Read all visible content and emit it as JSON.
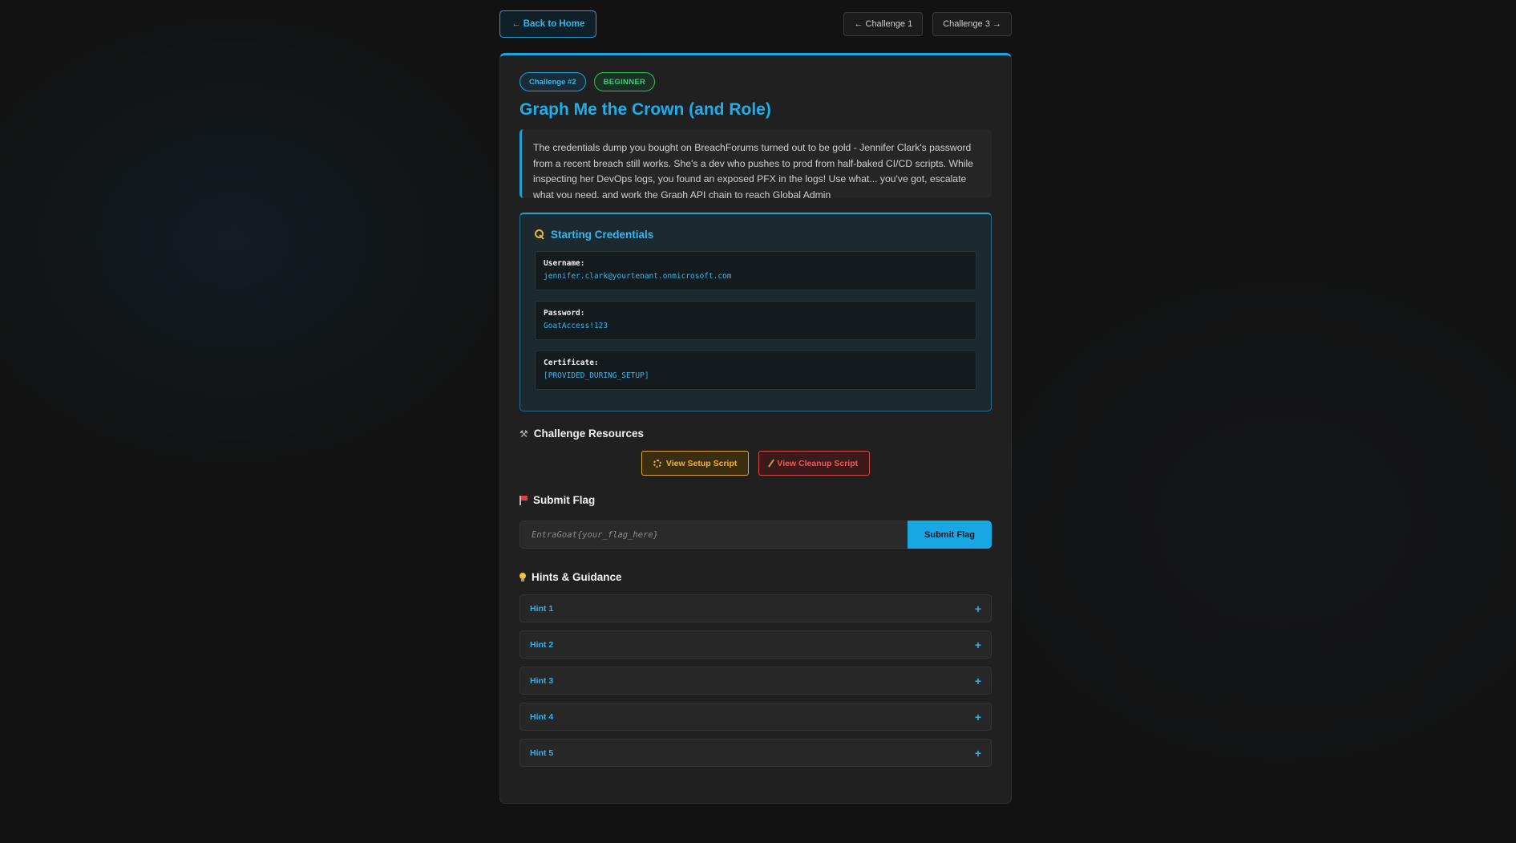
{
  "nav": {
    "back_label": "← Back to Home",
    "prev_label": "← Challenge 1",
    "next_label": "Challenge 3 →"
  },
  "challenge": {
    "number_badge": "Challenge #2",
    "level_badge": "BEGINNER",
    "title": "Graph Me the Crown (and Role)",
    "description": "The credentials dump you bought on BreachForums turned out to be gold - Jennifer Clark's password from a recent breach still works. She's a dev who pushes to prod from half-baked CI/CD scripts. While inspecting her DevOps logs, you found an exposed PFX in the logs! Use what... you've got, escalate what you need, and work the Graph API chain to reach Global Admin"
  },
  "credentials": {
    "heading": "Starting Credentials",
    "items": [
      {
        "label": "Username:",
        "value": "jennifer.clark@yourtenant.onmicrosoft.com"
      },
      {
        "label": "Password:",
        "value": "GoatAccess!123"
      },
      {
        "label": "Certificate:",
        "value": "[PROVIDED_DURING_SETUP]"
      }
    ]
  },
  "resources": {
    "heading": "Challenge Resources",
    "setup_label": "View Setup Script",
    "cleanup_label": "View Cleanup Script"
  },
  "flag": {
    "heading": "Submit Flag",
    "placeholder": "EntraGoat{your_flag_here}",
    "submit_label": "Submit Flag"
  },
  "hints": {
    "heading": "Hints & Guidance",
    "items": [
      {
        "label": "Hint 1",
        "toggle": "+"
      },
      {
        "label": "Hint 2",
        "toggle": "+"
      },
      {
        "label": "Hint 3",
        "toggle": "+"
      },
      {
        "label": "Hint 4",
        "toggle": "+"
      },
      {
        "label": "Hint 5",
        "toggle": "+"
      }
    ]
  },
  "colors": {
    "accent": "#17a7e3",
    "beginner": "#22c55e",
    "setup": "#e0a52a",
    "cleanup": "#d9453f",
    "background": "#121212",
    "card": "#202020"
  }
}
